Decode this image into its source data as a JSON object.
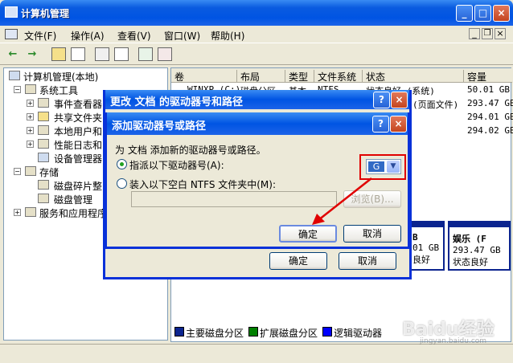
{
  "window": {
    "title": "计算机管理",
    "min": "_",
    "max": "□",
    "close": "×"
  },
  "menu": [
    "文件(F)",
    "操作(A)",
    "查看(V)",
    "窗口(W)",
    "帮助(H)"
  ],
  "menu_right": {
    "min": "_",
    "restore": "❐",
    "close": "×"
  },
  "toolbar": {
    "back": "←",
    "forward": "→"
  },
  "tree": {
    "root": "计算机管理(本地)",
    "system_tools": "系统工具",
    "event_viewer": "事件查看器",
    "shared_folders": "共享文件夹",
    "local_users": "本地用户和",
    "perf_logs": "性能日志和",
    "device_manager": "设备管理器",
    "storage": "存储",
    "defrag": "磁盘碎片整",
    "disk_mgmt": "磁盘管理",
    "services": "服务和应用程序"
  },
  "columns": [
    "卷",
    "布局",
    "类型",
    "文件系统",
    "状态",
    "容量"
  ],
  "rows": [
    {
      "vol": "WINXP (C:)",
      "layout": "磁盘分区",
      "type": "基本",
      "fs": "NTFS",
      "status": "状态良好 (系统)",
      "size": "50.01 GB"
    },
    {
      "vol": "",
      "layout": "",
      "type": "",
      "fs": "",
      "status": "(页面文件)",
      "size": "293.47 GB"
    },
    {
      "vol": "",
      "layout": "",
      "type": "",
      "fs": "",
      "status": "",
      "size": "294.01 GB"
    },
    {
      "vol": "",
      "layout": "",
      "type": "",
      "fs": "",
      "status": "",
      "size": "294.02 GB"
    }
  ],
  "disk_panel": {
    "part1_line1": "B",
    "part1_line2": "01 GB",
    "part1_line3": "良好",
    "part2_name": "娱乐 (F",
    "part2_size": "293.47 GB",
    "part2_status": "状态良好"
  },
  "legend": [
    "主要磁盘分区",
    "扩展磁盘分区",
    "逻辑驱动器"
  ],
  "legend_colors": {
    "primary": "#0B248F",
    "extended": "#008000",
    "logical": "#0000FF"
  },
  "outer_dialog": {
    "title": "更改 文档 的驱动器号和路径",
    "ok": "确定",
    "cancel": "取消",
    "help": "?",
    "close": "×"
  },
  "inner_dialog": {
    "title": "添加驱动器号或路径",
    "help": "?",
    "close": "×",
    "description": "为 文档 添加新的驱动器号或路径。",
    "option_letter": "指派以下驱动器号(A):",
    "option_folder": "装入以下空白 NTFS 文件夹中(M):",
    "drive_letter": "G",
    "browse": "浏览(B)...",
    "ok": "确定",
    "cancel": "取消"
  },
  "watermark": "Baidu经验",
  "watermark_url": "jingyan.baidu.com"
}
